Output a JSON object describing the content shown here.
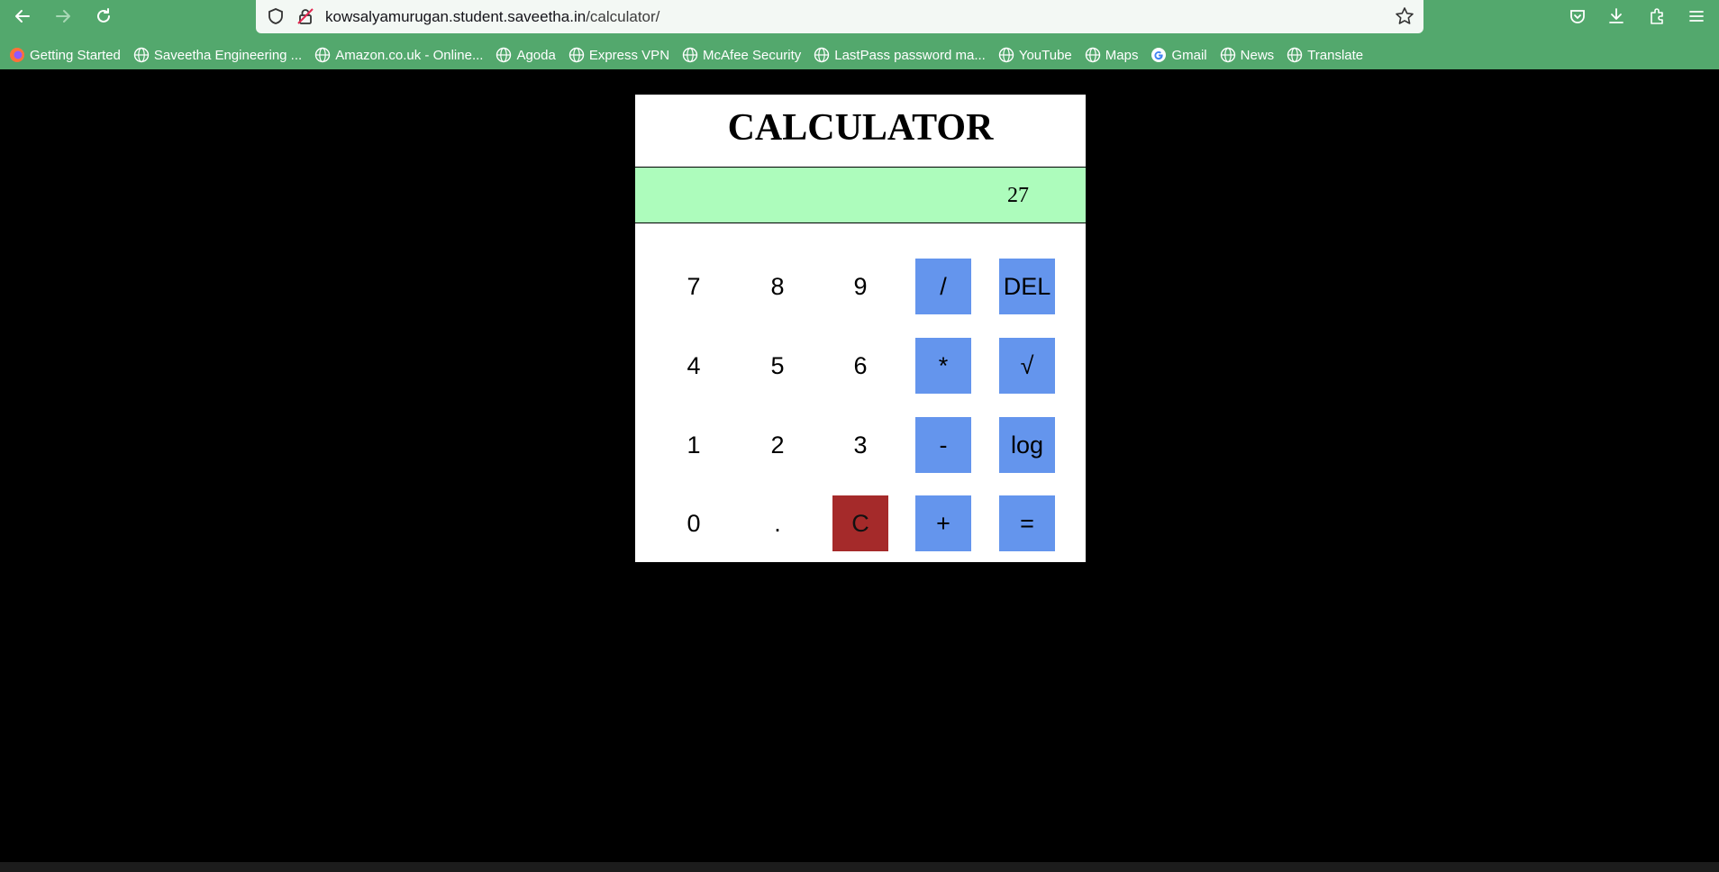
{
  "browser": {
    "url_host": "kowsalyamurugan.student.saveetha.in",
    "url_path": "/calculator/",
    "toolbar_color": "#53a86d",
    "nav_icons": [
      "back-arrow-icon",
      "forward-arrow-icon",
      "reload-icon"
    ],
    "right_icons": [
      "pocket-icon",
      "download-icon",
      "extensions-icon",
      "menu-icon"
    ],
    "bookmarks": [
      {
        "label": "Getting Started",
        "icon": "firefox-icon"
      },
      {
        "label": "Saveetha Engineering ...",
        "icon": "globe-icon"
      },
      {
        "label": "Amazon.co.uk - Online...",
        "icon": "globe-icon"
      },
      {
        "label": "Agoda",
        "icon": "globe-icon"
      },
      {
        "label": "Express VPN",
        "icon": "globe-icon"
      },
      {
        "label": "McAfee Security",
        "icon": "globe-icon"
      },
      {
        "label": "LastPass password ma...",
        "icon": "globe-icon"
      },
      {
        "label": "YouTube",
        "icon": "globe-icon"
      },
      {
        "label": "Maps",
        "icon": "globe-icon"
      },
      {
        "label": "Gmail",
        "icon": "google-icon"
      },
      {
        "label": "News",
        "icon": "globe-icon"
      },
      {
        "label": "Translate",
        "icon": "globe-icon"
      }
    ]
  },
  "calculator": {
    "title": "CALCULATOR",
    "display_value": "27",
    "display_color": "#adfcbc",
    "operator_color": "#6495ed",
    "clear_color": "#a52a2a",
    "keys": {
      "seven": "7",
      "eight": "8",
      "nine": "9",
      "divide": "/",
      "delete": "DEL",
      "four": "4",
      "five": "5",
      "six": "6",
      "multiply": "*",
      "sqrt": "√",
      "one": "1",
      "two": "2",
      "three": "3",
      "minus": "-",
      "log": "log",
      "zero": "0",
      "dot": ".",
      "clear": "C",
      "plus": "+",
      "equals": "="
    }
  }
}
